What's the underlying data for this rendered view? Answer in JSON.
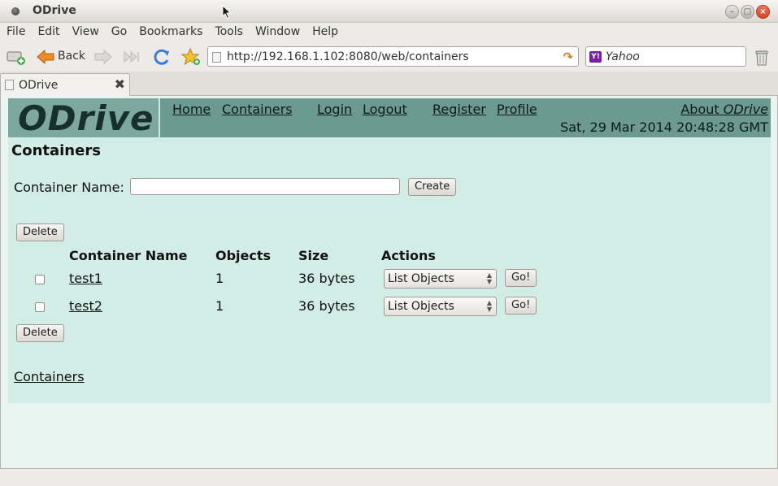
{
  "window": {
    "title": "ODrive"
  },
  "menubar": [
    "File",
    "Edit",
    "View",
    "Go",
    "Bookmarks",
    "Tools",
    "Window",
    "Help"
  ],
  "toolbar": {
    "back_label": "Back",
    "url": "http://192.168.1.102:8080/web/containers",
    "search_engine": "Yahoo"
  },
  "tab": {
    "label": "ODrive"
  },
  "site": {
    "logo": "ODrive",
    "nav": [
      "Home",
      "Containers",
      "Login",
      "Logout",
      "Register",
      "Profile"
    ],
    "about_prefix": "About",
    "about_brand": "ODrive",
    "datetime": "Sat, 29 Mar 2014 20:48:28 GMT"
  },
  "main": {
    "title": "Containers",
    "container_name_label": "Container Name:",
    "container_name_value": "",
    "create_label": "Create",
    "delete_label": "Delete",
    "columns": [
      "Container Name",
      "Objects",
      "Size",
      "Actions"
    ],
    "rows": [
      {
        "name": "test1",
        "objects": "1",
        "size": "36 bytes",
        "action": "List Objects",
        "go": "Go!"
      },
      {
        "name": "test2",
        "objects": "1",
        "size": "36 bytes",
        "action": "List Objects",
        "go": "Go!"
      }
    ],
    "footer_link": "Containers"
  }
}
